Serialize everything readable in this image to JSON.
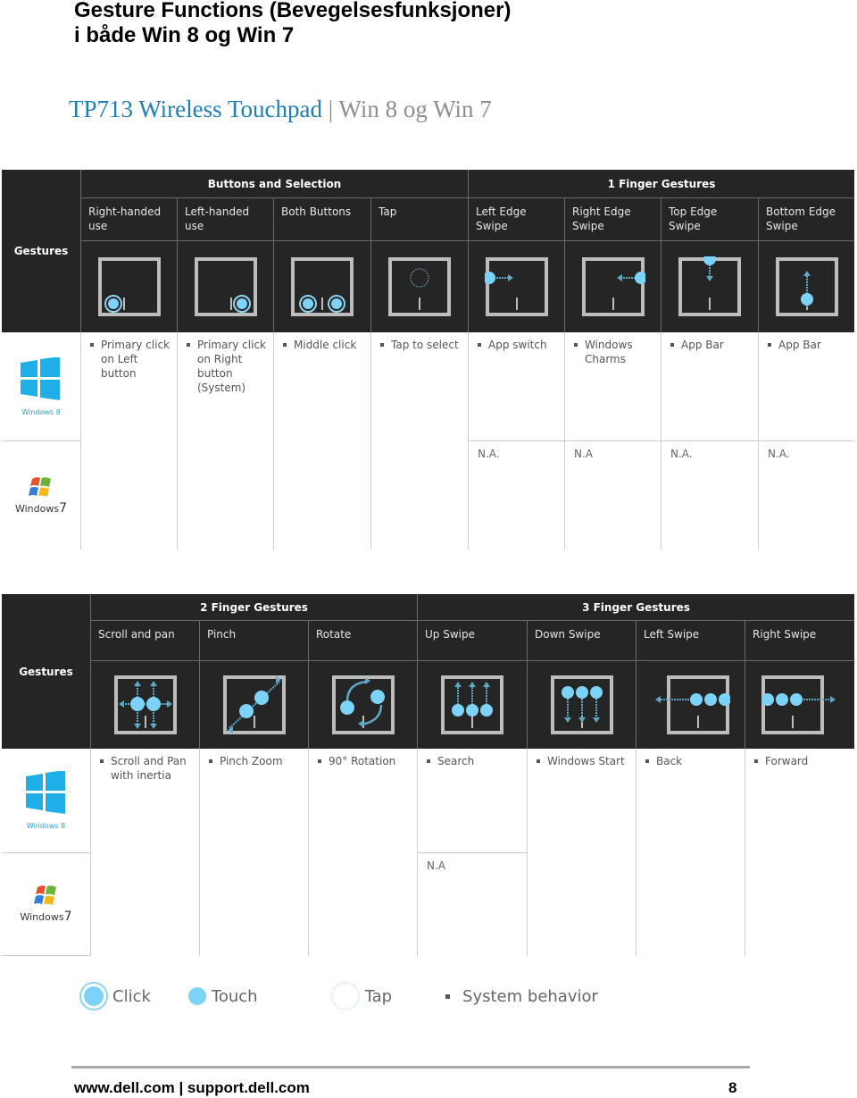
{
  "page": {
    "title_line1": "Gesture Functions (Bevegelsesfunksjoner)",
    "title_line2": "i både Win 8 og Win 7",
    "subtitle_product": "TP713 Wireless Touchpad",
    "subtitle_separator": " | ",
    "subtitle_os": "Win 8 og Win 7"
  },
  "colors": {
    "header_bg": "#252525",
    "accent_blue": "#1f7fb5",
    "touch_blue": "#7dd3f7",
    "arrow_blue": "#5aa9c9"
  },
  "table1": {
    "row_label": "Gestures",
    "groups": [
      "Buttons and Selection",
      "1 Finger Gestures"
    ],
    "columns": [
      {
        "header": "Right-handed use",
        "icon": "right-handed-click-icon",
        "win8": [
          "Primary click on Left button"
        ],
        "win7": null
      },
      {
        "header": "Left-handed use",
        "icon": "left-handed-click-icon",
        "win8": [
          "Primary click on Right button (System)"
        ],
        "win7": null
      },
      {
        "header": "Both Buttons",
        "icon": "both-buttons-click-icon",
        "win8": [
          "Middle click"
        ],
        "win7": null
      },
      {
        "header": "Tap",
        "icon": "tap-icon",
        "win8": [
          "Tap to select"
        ],
        "win7": null
      },
      {
        "header": "Left Edge Swipe",
        "icon": "left-edge-swipe-icon",
        "win8": [
          "App switch"
        ],
        "win7": "N.A."
      },
      {
        "header": "Right Edge Swipe",
        "icon": "right-edge-swipe-icon",
        "win8": [
          "Windows Charms"
        ],
        "win7": "N.A"
      },
      {
        "header": "Top Edge Swipe",
        "icon": "top-edge-swipe-icon",
        "win8": [
          "App Bar"
        ],
        "win7": "N.A."
      },
      {
        "header": "Bottom Edge Swipe",
        "icon": "bottom-edge-swipe-icon",
        "win8": [
          "App Bar"
        ],
        "win7": "N.A."
      }
    ]
  },
  "table2": {
    "row_label": "Gestures",
    "groups": [
      "2 Finger Gestures",
      "3 Finger Gestures"
    ],
    "columns": [
      {
        "header": "Scroll and pan",
        "icon": "scroll-pan-icon",
        "win8": [
          "Scroll and Pan with inertia"
        ],
        "win7": null
      },
      {
        "header": "Pinch",
        "icon": "pinch-icon",
        "win8": [
          "Pinch Zoom"
        ],
        "win7": null
      },
      {
        "header": "Rotate",
        "icon": "rotate-icon",
        "win8": [
          "90° Rotation"
        ],
        "win7": null
      },
      {
        "header": "Up Swipe",
        "icon": "three-finger-up-icon",
        "win8": [
          "Search"
        ],
        "win7": "N.A"
      },
      {
        "header": "Down Swipe",
        "icon": "three-finger-down-icon",
        "win8": [
          "Windows Start"
        ],
        "win7": null
      },
      {
        "header": "Left Swipe",
        "icon": "three-finger-left-icon",
        "win8": [
          "Back"
        ],
        "win7": null
      },
      {
        "header": "Right Swipe",
        "icon": "three-finger-right-icon",
        "win8": [
          "Forward"
        ],
        "win7": null
      }
    ]
  },
  "os": {
    "win8_label": "Windows 8",
    "win7_label_a": "Windows",
    "win7_label_b": "7"
  },
  "legend": {
    "click": "Click",
    "touch": "Touch",
    "tap": "Tap",
    "system": "System behavior"
  },
  "footer": {
    "links": "www.dell.com | support.dell.com",
    "page_number": "8"
  }
}
